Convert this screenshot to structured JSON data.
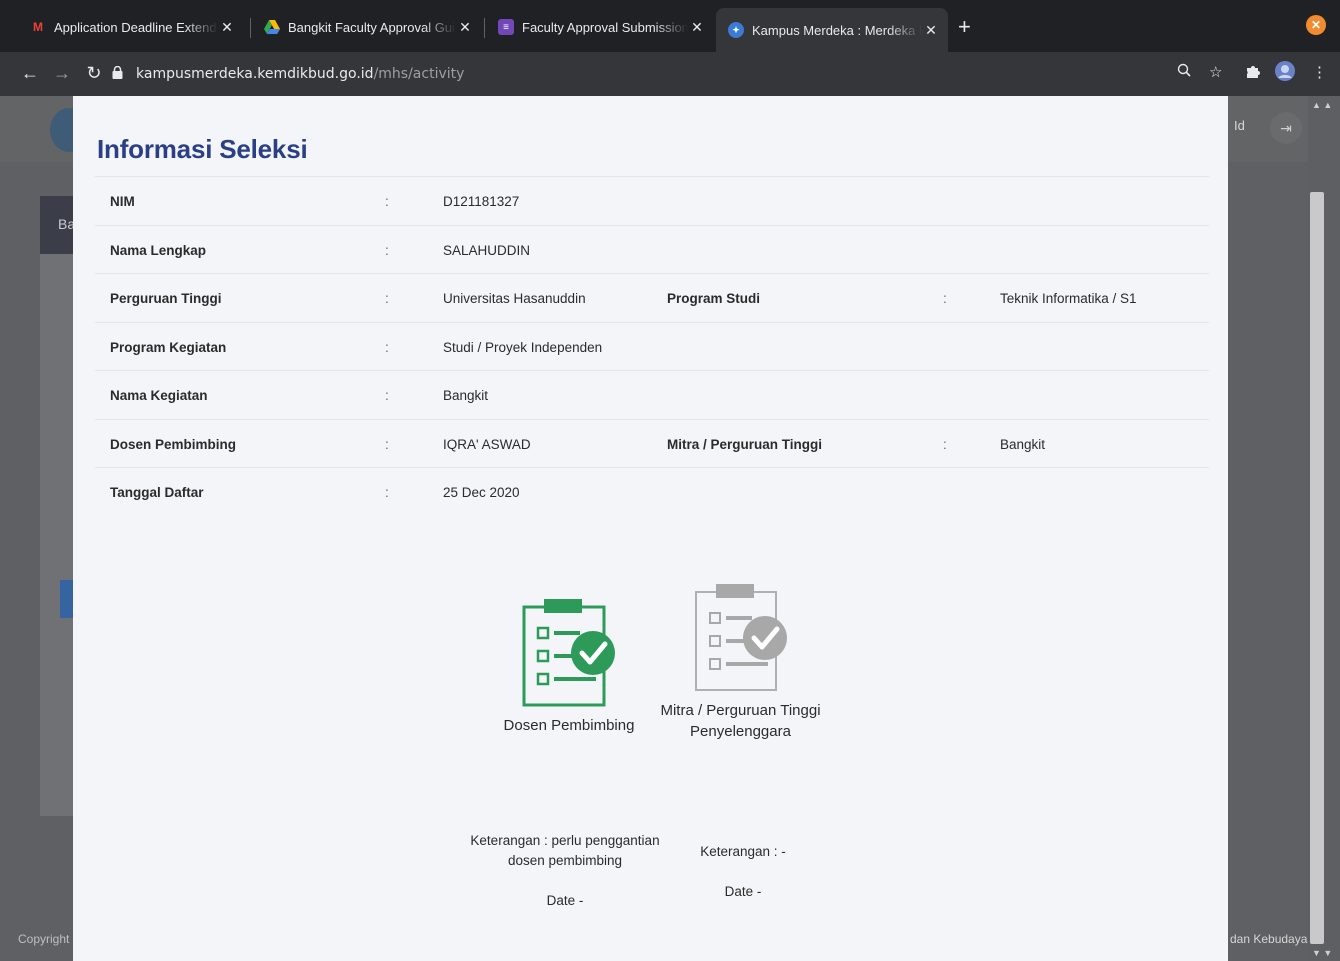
{
  "browser": {
    "tabs": [
      {
        "title": "Application Deadline Extended",
        "icon": "gmail-icon",
        "color": "#ea4335"
      },
      {
        "title": "Bangkit Faculty Approval Guide",
        "icon": "google-drive-icon",
        "color": "#fbbc04"
      },
      {
        "title": "Faculty Approval Submission",
        "icon": "google-forms-icon",
        "color": "#7248b9"
      },
      {
        "title": "Kampus Merdeka : Merdeka Belajar",
        "icon": "kampus-merdeka-icon",
        "color": "#3a7bd5",
        "active": true
      }
    ],
    "new_tab_label": "+",
    "address": {
      "host": "kampusmerdeka.kemdikbud.go.id",
      "path": "/mhs/activity"
    }
  },
  "background_page": {
    "header_right_text": "Id",
    "sidebar_tab_fragment": "Ba",
    "footer_left": "Copyright ©",
    "footer_right": "dan Kebudayaan"
  },
  "modal": {
    "title": "Informasi Seleksi",
    "rows": [
      {
        "label": "NIM",
        "value": "D121181327"
      },
      {
        "label": "Nama Lengkap",
        "value": "SALAHUDDIN"
      },
      {
        "label": "Perguruan Tinggi",
        "value": "Universitas Hasanuddin",
        "label2": "Program Studi",
        "value2": "Teknik Informatika / S1"
      },
      {
        "label": "Program Kegiatan",
        "value": "Studi / Proyek Independen"
      },
      {
        "label": "Nama Kegiatan",
        "value": "Bangkit"
      },
      {
        "label": "Dosen Pembimbing",
        "value": "IQRA' ASWAD",
        "label2": "Mitra / Perguruan Tinggi",
        "value2": "Bangkit"
      },
      {
        "label": "Tanggal Daftar",
        "value": "25 Dec 2020"
      }
    ],
    "colon": ":",
    "approvals": [
      {
        "name": "Dosen Pembimbing",
        "status": "approved",
        "color": "#2e9a5a",
        "note_line1": "Keterangan : perlu penggantian",
        "note_line2": "dosen pembimbing",
        "date": "Date -"
      },
      {
        "name_line1": "Mitra / Perguruan Tinggi",
        "name_line2": "Penyelenggara",
        "status": "pending",
        "color": "#a8a8a8",
        "note_line1": "Keterangan : -",
        "date": "Date -"
      }
    ]
  }
}
